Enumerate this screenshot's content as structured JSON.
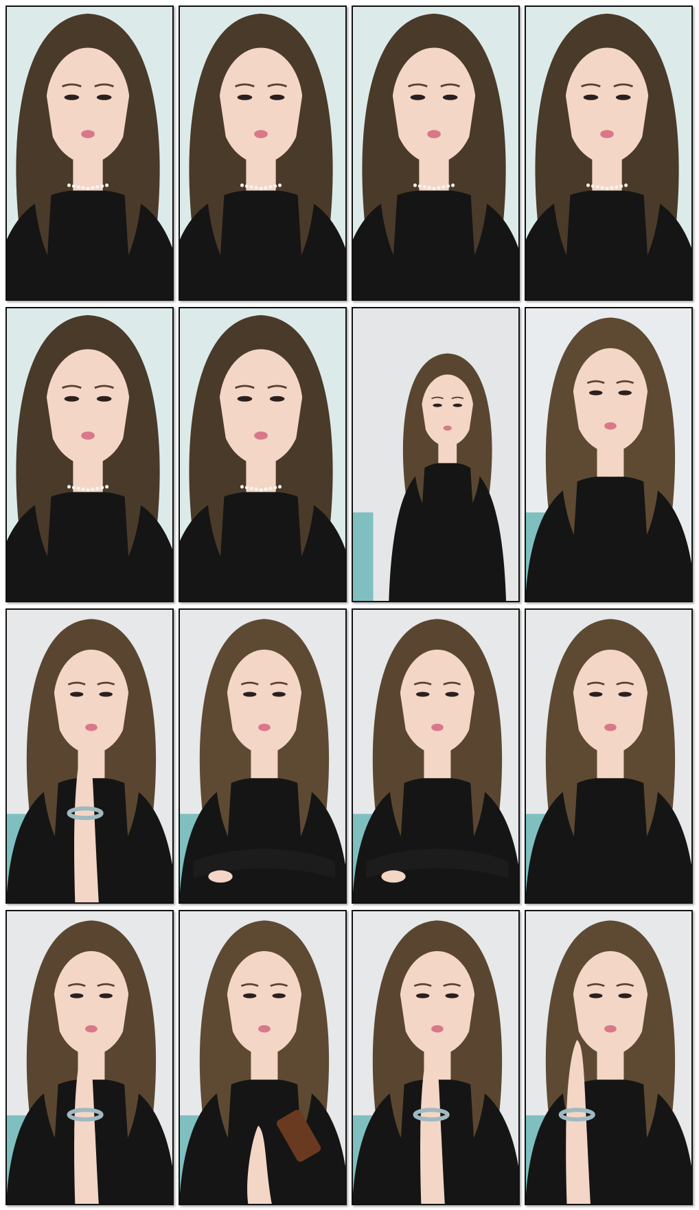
{
  "contact_sheet": {
    "columns": 4,
    "rows": 4,
    "frames": [
      {
        "scene": "closeup-talking",
        "bg": "#dcebea",
        "hair": "#4a3a2a",
        "top": "#151515"
      },
      {
        "scene": "closeup-talking",
        "bg": "#dcebea",
        "hair": "#4a3a2a",
        "top": "#151515"
      },
      {
        "scene": "closeup-talking",
        "bg": "#dcebea",
        "hair": "#4a3a2a",
        "top": "#151515"
      },
      {
        "scene": "closeup-talking",
        "bg": "#dcebea",
        "hair": "#4a3a2a",
        "top": "#151515"
      },
      {
        "scene": "closeup-talking",
        "bg": "#dcebea",
        "hair": "#4a3a2a",
        "top": "#151515"
      },
      {
        "scene": "closeup-talking",
        "bg": "#dcebea",
        "hair": "#4a3a2a",
        "top": "#151515"
      },
      {
        "scene": "seated-leaning",
        "bg": "#e4e6e8",
        "hair": "#5a4630",
        "top": "#151515"
      },
      {
        "scene": "head-tilt",
        "bg": "#e9ecef",
        "hair": "#5e4a33",
        "top": "#151515"
      },
      {
        "scene": "hand-on-chin",
        "bg": "#e6e8ea",
        "hair": "#5a4630",
        "top": "#151515"
      },
      {
        "scene": "arms-crossed",
        "bg": "#e6e8ea",
        "hair": "#5e4a33",
        "top": "#151515"
      },
      {
        "scene": "arms-crossed",
        "bg": "#e6e8ea",
        "hair": "#5a4630",
        "top": "#151515"
      },
      {
        "scene": "talking",
        "bg": "#e6e8ea",
        "hair": "#5e4a33",
        "top": "#151515"
      },
      {
        "scene": "hand-near-mouth",
        "bg": "#e6e8ea",
        "hair": "#5a4630",
        "top": "#151515"
      },
      {
        "scene": "holding-phone",
        "bg": "#e6e8ea",
        "hair": "#5e4a33",
        "top": "#151515"
      },
      {
        "scene": "hand-near-mouth",
        "bg": "#e6e8ea",
        "hair": "#5a4630",
        "top": "#151515"
      },
      {
        "scene": "hand-at-ear",
        "bg": "#e6e8ea",
        "hair": "#5e4a33",
        "top": "#151515"
      }
    ]
  }
}
